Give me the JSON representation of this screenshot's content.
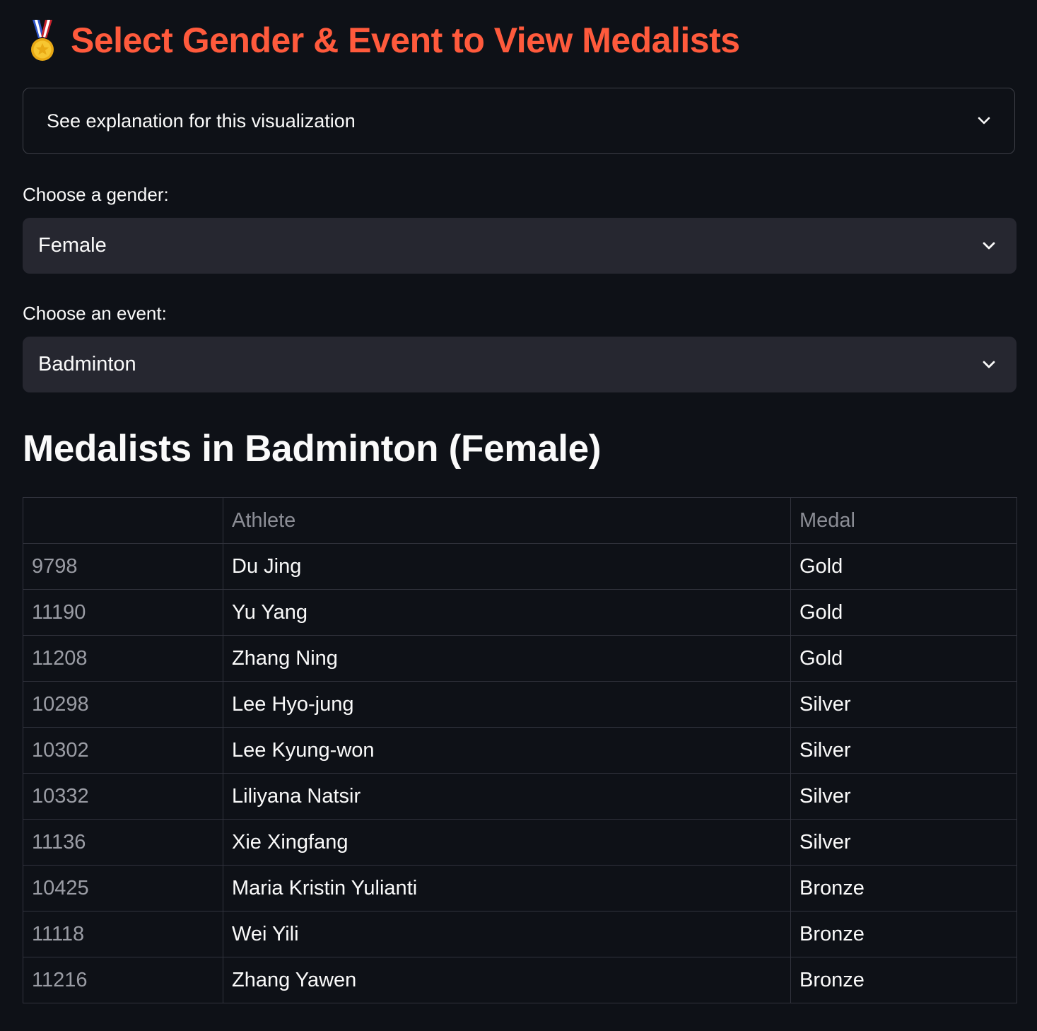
{
  "header": {
    "icon": "medal-icon",
    "title": "Select Gender & Event to View Medalists",
    "title_color": "#ff5a3c"
  },
  "expander": {
    "label": "See explanation for this visualization",
    "icon": "chevron-down-icon"
  },
  "gender_select": {
    "label": "Choose a gender:",
    "value": "Female"
  },
  "event_select": {
    "label": "Choose an event:",
    "value": "Badminton"
  },
  "results": {
    "heading": "Medalists in Badminton (Female)",
    "columns": [
      "",
      "Athlete",
      "Medal"
    ],
    "rows": [
      {
        "index": "9798",
        "athlete": "Du Jing",
        "medal": "Gold"
      },
      {
        "index": "11190",
        "athlete": "Yu Yang",
        "medal": "Gold"
      },
      {
        "index": "11208",
        "athlete": "Zhang Ning",
        "medal": "Gold"
      },
      {
        "index": "10298",
        "athlete": "Lee Hyo-jung",
        "medal": "Silver"
      },
      {
        "index": "10302",
        "athlete": "Lee Kyung-won",
        "medal": "Silver"
      },
      {
        "index": "10332",
        "athlete": "Liliyana Natsir",
        "medal": "Silver"
      },
      {
        "index": "11136",
        "athlete": "Xie Xingfang",
        "medal": "Silver"
      },
      {
        "index": "10425",
        "athlete": "Maria Kristin Yulianti",
        "medal": "Bronze"
      },
      {
        "index": "11118",
        "athlete": "Wei Yili",
        "medal": "Bronze"
      },
      {
        "index": "11216",
        "athlete": "Zhang Yawen",
        "medal": "Bronze"
      }
    ]
  },
  "colors": {
    "background": "#0e1117",
    "select_background": "#262730",
    "accent": "#ff5a3c"
  }
}
